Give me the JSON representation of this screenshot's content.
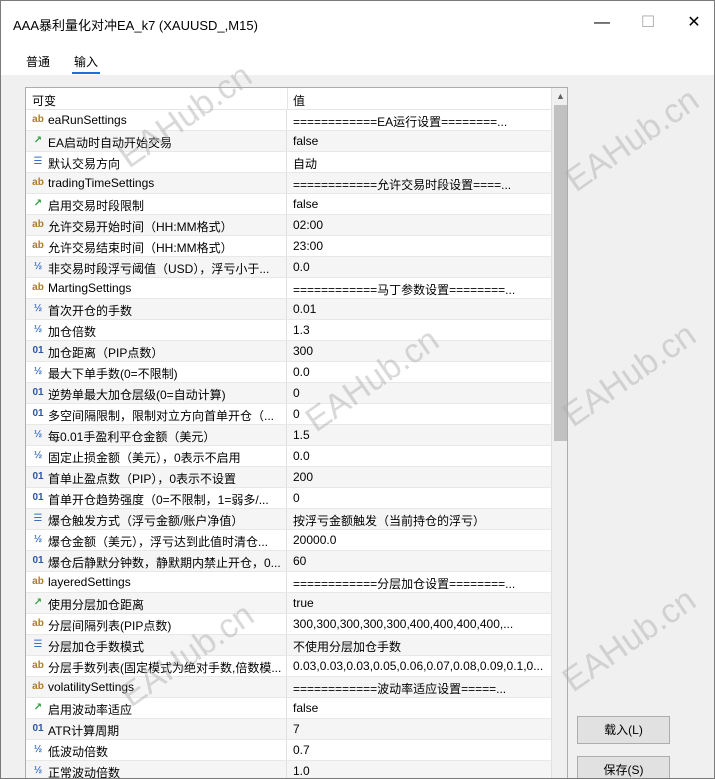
{
  "window": {
    "title": "AAA暴利量化对冲EA_k7 (XAUUSD_,M15)",
    "minimize_glyph": "—",
    "maximize_glyph": "☐",
    "close_glyph": "✕"
  },
  "tabs": [
    {
      "label": "普通",
      "active": false
    },
    {
      "label": "输入",
      "active": true
    }
  ],
  "grid": {
    "header_variable": "可变",
    "header_value": "值",
    "rows": [
      {
        "icon": "string-icon",
        "glyph": "ab",
        "name": "eaRunSettings",
        "value": "============EA运行设置========..."
      },
      {
        "icon": "bool-icon",
        "glyph": "↗",
        "name": "EA启动时自动开始交易",
        "value": "false"
      },
      {
        "icon": "enum-icon",
        "glyph": "☰",
        "name": "默认交易方向",
        "value": "自动"
      },
      {
        "icon": "string-icon",
        "glyph": "ab",
        "name": "tradingTimeSettings",
        "value": "============允许交易时段设置====..."
      },
      {
        "icon": "bool-icon",
        "glyph": "↗",
        "name": "启用交易时段限制",
        "value": "false"
      },
      {
        "icon": "string-icon",
        "glyph": "ab",
        "name": "允许交易开始时间（HH:MM格式）",
        "value": "02:00"
      },
      {
        "icon": "string-icon",
        "glyph": "ab",
        "name": "允许交易结束时间（HH:MM格式）",
        "value": "23:00"
      },
      {
        "icon": "double-icon",
        "glyph": "½",
        "name": "非交易时段浮亏阈值（USD），浮亏小于...",
        "value": "0.0"
      },
      {
        "icon": "string-icon",
        "glyph": "ab",
        "name": "MartingSettings",
        "value": "============马丁参数设置========..."
      },
      {
        "icon": "double-icon",
        "glyph": "½",
        "name": "首次开仓的手数",
        "value": "0.01"
      },
      {
        "icon": "double-icon",
        "glyph": "½",
        "name": "加仓倍数",
        "value": "1.3"
      },
      {
        "icon": "int-icon",
        "glyph": "01",
        "name": "加仓距离（PIP点数）",
        "value": "300"
      },
      {
        "icon": "double-icon",
        "glyph": "½",
        "name": "最大下单手数(0=不限制)",
        "value": "0.0"
      },
      {
        "icon": "int-icon",
        "glyph": "01",
        "name": "逆势单最大加仓层级(0=自动计算)",
        "value": "0"
      },
      {
        "icon": "int-icon",
        "glyph": "01",
        "name": "多空间隔限制，限制对立方向首单开仓（...",
        "value": "0"
      },
      {
        "icon": "double-icon",
        "glyph": "½",
        "name": "每0.01手盈利平仓金额（美元）",
        "value": "1.5"
      },
      {
        "icon": "double-icon",
        "glyph": "½",
        "name": "固定止损金额（美元），0表示不启用",
        "value": "0.0"
      },
      {
        "icon": "int-icon",
        "glyph": "01",
        "name": "首单止盈点数（PIP），0表示不设置",
        "value": "200"
      },
      {
        "icon": "int-icon",
        "glyph": "01",
        "name": "首单开仓趋势强度（0=不限制，1=弱多/...",
        "value": "0"
      },
      {
        "icon": "enum-icon",
        "glyph": "☰",
        "name": "爆仓触发方式（浮亏金额/账户净值）",
        "value": "按浮亏金额触发（当前持仓的浮亏）"
      },
      {
        "icon": "double-icon",
        "glyph": "½",
        "name": "爆仓金额（美元），浮亏达到此值时清仓...",
        "value": "20000.0"
      },
      {
        "icon": "int-icon",
        "glyph": "01",
        "name": "爆仓后静默分钟数，静默期内禁止开仓，0...",
        "value": "60"
      },
      {
        "icon": "string-icon",
        "glyph": "ab",
        "name": "layeredSettings",
        "value": "============分层加仓设置========..."
      },
      {
        "icon": "bool-icon",
        "glyph": "↗",
        "name": "使用分层加仓距离",
        "value": "true"
      },
      {
        "icon": "string-icon",
        "glyph": "ab",
        "name": "分层间隔列表(PIP点数)",
        "value": "300,300,300,300,300,400,400,400,400,..."
      },
      {
        "icon": "enum-icon",
        "glyph": "☰",
        "name": "分层加仓手数模式",
        "value": "不使用分层加仓手数"
      },
      {
        "icon": "string-icon",
        "glyph": "ab",
        "name": "分层手数列表(固定模式为绝对手数,倍数模...",
        "value": "0.03,0.03,0.03,0.05,0.06,0.07,0.08,0.09,0.1,0..."
      },
      {
        "icon": "string-icon",
        "glyph": "ab",
        "name": "volatilitySettings",
        "value": "============波动率适应设置=====..."
      },
      {
        "icon": "bool-icon",
        "glyph": "↗",
        "name": "启用波动率适应",
        "value": "false"
      },
      {
        "icon": "int-icon",
        "glyph": "01",
        "name": "ATR计算周期",
        "value": "7"
      },
      {
        "icon": "double-icon",
        "glyph": "½",
        "name": "低波动倍数",
        "value": "0.7"
      },
      {
        "icon": "double-icon",
        "glyph": "½",
        "name": "正常波动倍数",
        "value": "1.0"
      }
    ]
  },
  "buttons": {
    "load_label": "载入(L)",
    "save_label": "保存(S)"
  },
  "scrollbar": {
    "up_glyph": "▲"
  },
  "watermark": {
    "text": "EAHub.cn"
  }
}
